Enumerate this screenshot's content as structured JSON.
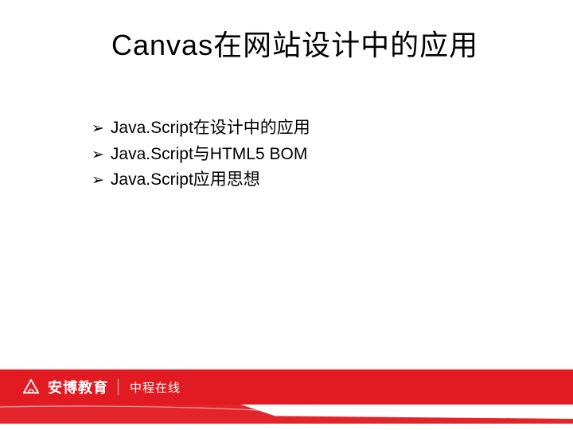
{
  "title": "Canvas在网站设计中的应用",
  "bullets": [
    {
      "marker": "➢",
      "text": "Java.Script在设计中的应用"
    },
    {
      "marker": "➢",
      "text": "Java.Script与HTML5  BOM"
    },
    {
      "marker": "➢",
      "text": "Java.Script应用思想"
    }
  ],
  "footer": {
    "brand_main": "安博教育",
    "brand_sub": "中程在线",
    "accent_color": "#e21b22"
  }
}
